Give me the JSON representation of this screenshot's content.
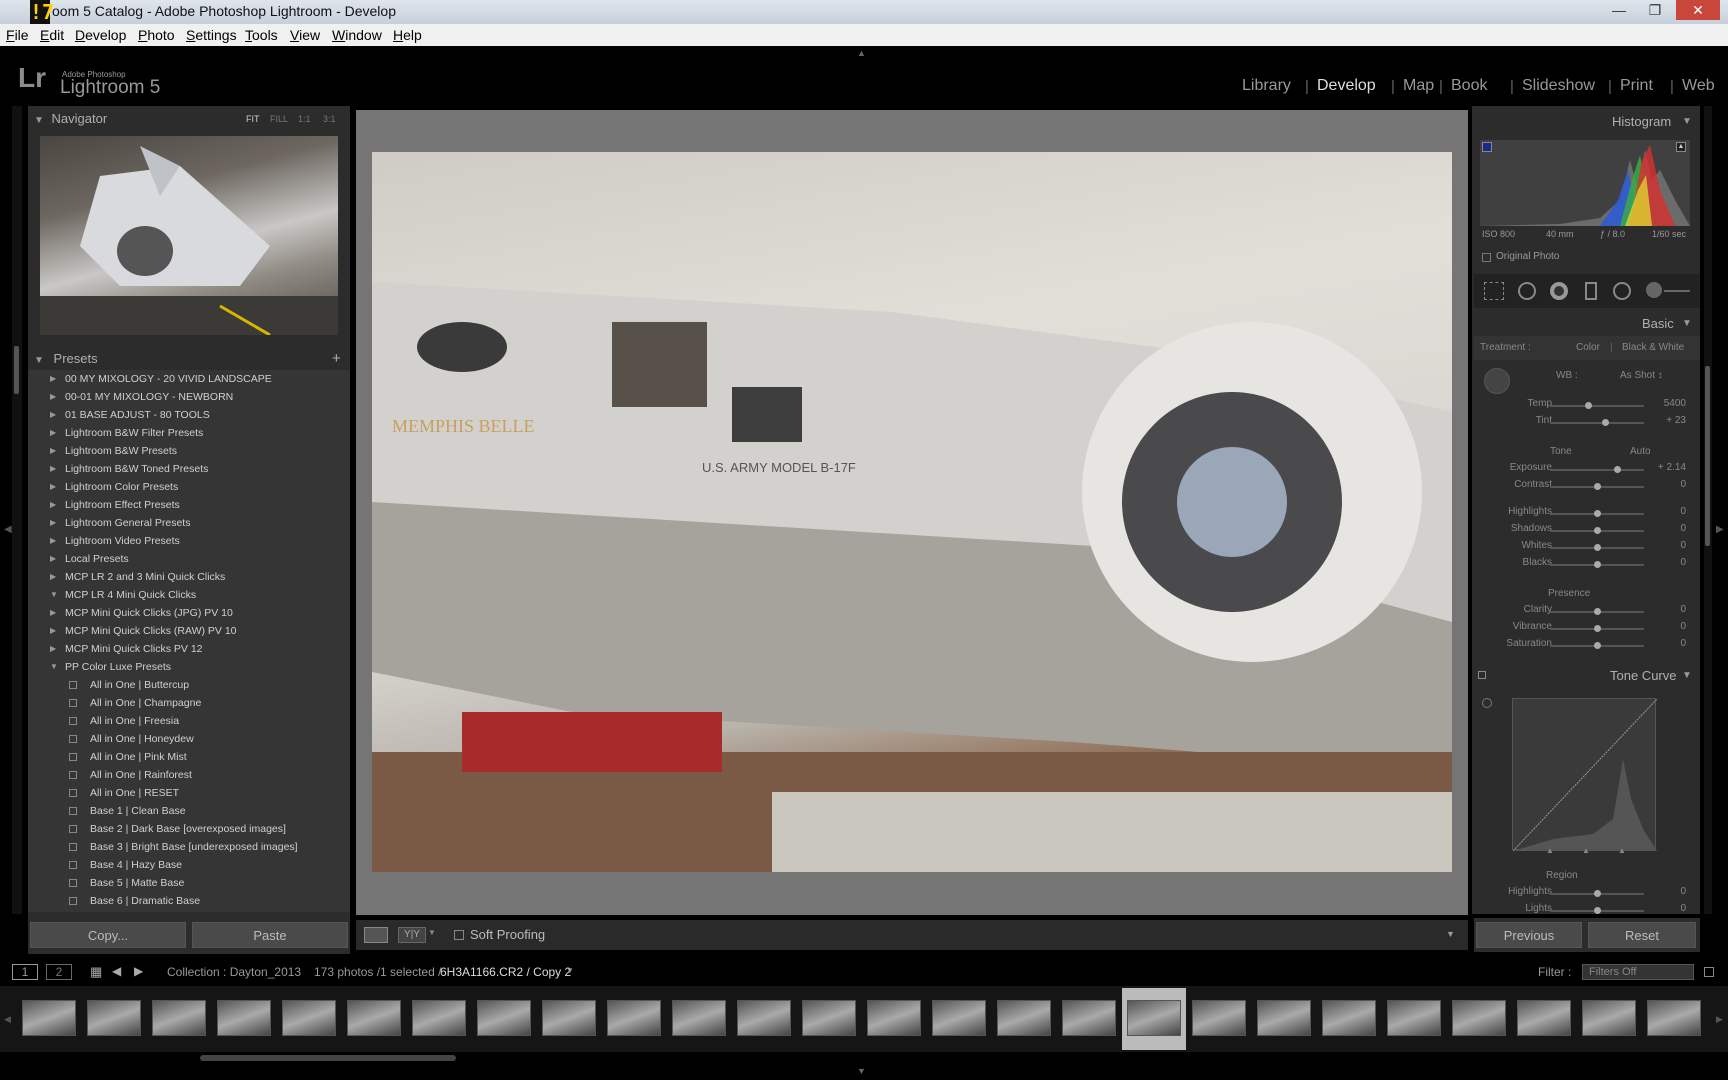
{
  "window": {
    "title": "oom 5 Catalog - Adobe Photoshop Lightroom - Develop",
    "logo": "lr"
  },
  "menu": [
    {
      "label": "File",
      "u": "F",
      "rest": "ile"
    },
    {
      "label": "Edit",
      "u": "E",
      "rest": "dit"
    },
    {
      "label": "Develop",
      "u": "D",
      "rest": "evelop"
    },
    {
      "label": "Photo",
      "u": "P",
      "rest": "hoto"
    },
    {
      "label": "Settings",
      "u": "S",
      "rest": "ettings"
    },
    {
      "label": "Tools",
      "u": "T",
      "rest": "ools"
    },
    {
      "label": "View",
      "u": "V",
      "rest": "iew"
    },
    {
      "label": "Window",
      "u": "W",
      "rest": "indow"
    },
    {
      "label": "Help",
      "u": "H",
      "rest": "elp"
    }
  ],
  "identity": {
    "logo": "Lr",
    "line1": "Adobe Photoshop",
    "line2": "Lightroom 5"
  },
  "modules": [
    "Library",
    "Develop",
    "Map",
    "Book",
    "Slideshow",
    "Print",
    "Web"
  ],
  "active_module": "Develop",
  "navigator": {
    "title": "Navigator",
    "zoom": [
      "FIT",
      "FILL",
      "1:1",
      "3:1"
    ]
  },
  "presets": {
    "title": "Presets",
    "add": "+",
    "items": [
      {
        "label": "00 MY MIXOLOGY - 20 VIVID LANDSCAPE",
        "type": "folder",
        "open": false
      },
      {
        "label": "00-01 MY MIXOLOGY - NEWBORN",
        "type": "folder",
        "open": false
      },
      {
        "label": "01 BASE ADJUST - 80 TOOLS",
        "type": "folder",
        "open": false
      },
      {
        "label": "Lightroom B&W Filter Presets",
        "type": "folder",
        "open": false
      },
      {
        "label": "Lightroom B&W Presets",
        "type": "folder",
        "open": false
      },
      {
        "label": "Lightroom B&W Toned Presets",
        "type": "folder",
        "open": false
      },
      {
        "label": "Lightroom Color Presets",
        "type": "folder",
        "open": false
      },
      {
        "label": "Lightroom Effect Presets",
        "type": "folder",
        "open": false
      },
      {
        "label": "Lightroom General Presets",
        "type": "folder",
        "open": false
      },
      {
        "label": "Lightroom Video Presets",
        "type": "folder",
        "open": false
      },
      {
        "label": "Local Presets",
        "type": "folder",
        "open": false
      },
      {
        "label": "MCP LR 2 and 3 Mini Quick Clicks",
        "type": "folder",
        "open": false
      },
      {
        "label": "MCP LR 4 Mini Quick Clicks",
        "type": "folder",
        "open": true
      },
      {
        "label": "MCP Mini Quick Clicks (JPG) PV 10",
        "type": "folder",
        "open": false
      },
      {
        "label": "MCP Mini Quick Clicks (RAW) PV 10",
        "type": "folder",
        "open": false
      },
      {
        "label": "MCP Mini Quick Clicks PV 12",
        "type": "folder",
        "open": false
      },
      {
        "label": "PP Color Luxe Presets",
        "type": "folder",
        "open": true
      },
      {
        "label": "All in One | Buttercup",
        "type": "preset"
      },
      {
        "label": "All in One | Champagne",
        "type": "preset"
      },
      {
        "label": "All in One | Freesia",
        "type": "preset"
      },
      {
        "label": "All in One | Honeydew",
        "type": "preset"
      },
      {
        "label": "All in One | Pink Mist",
        "type": "preset"
      },
      {
        "label": "All in One | Rainforest",
        "type": "preset"
      },
      {
        "label": "All in One | RESET",
        "type": "preset"
      },
      {
        "label": "Base 1 | Clean Base",
        "type": "preset"
      },
      {
        "label": "Base 2 | Dark Base [overexposed images]",
        "type": "preset"
      },
      {
        "label": "Base 3 | Bright Base [underexposed images]",
        "type": "preset"
      },
      {
        "label": "Base 4 | Hazy Base",
        "type": "preset"
      },
      {
        "label": "Base 5 | Matte Base",
        "type": "preset"
      },
      {
        "label": "Base 6 | Dramatic Base",
        "type": "preset"
      }
    ]
  },
  "left_buttons": {
    "copy": "Copy...",
    "paste": "Paste"
  },
  "toolbar": {
    "soft_proofing": "Soft Proofing",
    "yy": "Y|Y"
  },
  "histogram": {
    "title": "Histogram",
    "iso": "ISO 800",
    "focal": "40 mm",
    "aperture": "ƒ / 8.0",
    "shutter": "1/60 sec",
    "original_photo": "Original Photo"
  },
  "basic": {
    "title": "Basic",
    "treatment_label": "Treatment :",
    "treatment_color": "Color",
    "treatment_bw": "Black & White",
    "wb_label": "WB :",
    "wb_value": "As Shot ↕",
    "tone_label": "Tone",
    "tone_auto": "Auto",
    "presence_label": "Presence",
    "sliders": [
      {
        "label": "Temp",
        "value": "5400",
        "pos": 0.4
      },
      {
        "label": "Tint",
        "value": "+ 23",
        "pos": 0.58
      },
      {
        "label": "Exposure",
        "value": "+ 2.14",
        "pos": 0.71
      },
      {
        "label": "Contrast",
        "value": "0",
        "pos": 0.5
      },
      {
        "label": "Highlights",
        "value": "0",
        "pos": 0.5
      },
      {
        "label": "Shadows",
        "value": "0",
        "pos": 0.5
      },
      {
        "label": "Whites",
        "value": "0",
        "pos": 0.5
      },
      {
        "label": "Blacks",
        "value": "0",
        "pos": 0.5
      },
      {
        "label": "Clarity",
        "value": "0",
        "pos": 0.5
      },
      {
        "label": "Vibrance",
        "value": "0",
        "pos": 0.5
      },
      {
        "label": "Saturation",
        "value": "0",
        "pos": 0.5
      }
    ]
  },
  "tone_curve": {
    "title": "Tone Curve",
    "region_label": "Region",
    "sliders": [
      {
        "label": "Highlights",
        "value": "0",
        "pos": 0.5
      },
      {
        "label": "Lights",
        "value": "0",
        "pos": 0.5
      }
    ]
  },
  "right_buttons": {
    "previous": "Previous",
    "reset": "Reset"
  },
  "filmbar": {
    "page1": "1",
    "page2": "2",
    "collection": "Collection : Dayton_2013",
    "count": "173 photos /1 selected /",
    "filename": "6H3A1166.CR2 / Copy 2",
    "filter_label": "Filter :",
    "filter_value": "Filters Off"
  },
  "filmstrip": {
    "count": 26,
    "selected_index": 17
  },
  "colors": {
    "accent": "#dddddd",
    "panel": "#2c2c2c",
    "background": "#000000"
  }
}
